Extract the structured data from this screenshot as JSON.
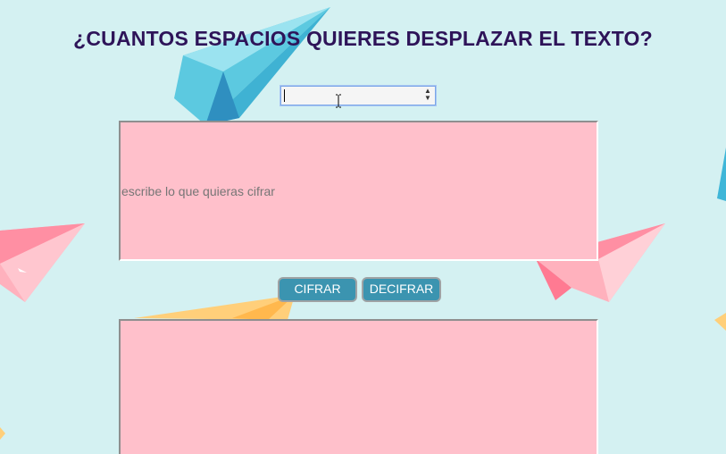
{
  "header": {
    "title": "¿CUANTOS ESPACIOS QUIERES DESPLAZAR EL TEXTO?"
  },
  "shift_select": {
    "selected_value": ""
  },
  "input_box": {
    "placeholder": "escribe lo que quieras cifrar",
    "value": ""
  },
  "buttons": {
    "cipher_label": "CIFRAR",
    "decipher_label": "DECIFRAR"
  },
  "output_box": {
    "value": ""
  },
  "colors": {
    "background": "#d4f1f2",
    "title": "#2e1459",
    "text_area_fill": "#ffc0cb",
    "button_fill": "#3b94b0",
    "button_text": "#ffffff"
  },
  "decorations": [
    "paper-plane-blue-icon",
    "paper-plane-pink-icon",
    "paper-plane-yellow-icon"
  ]
}
